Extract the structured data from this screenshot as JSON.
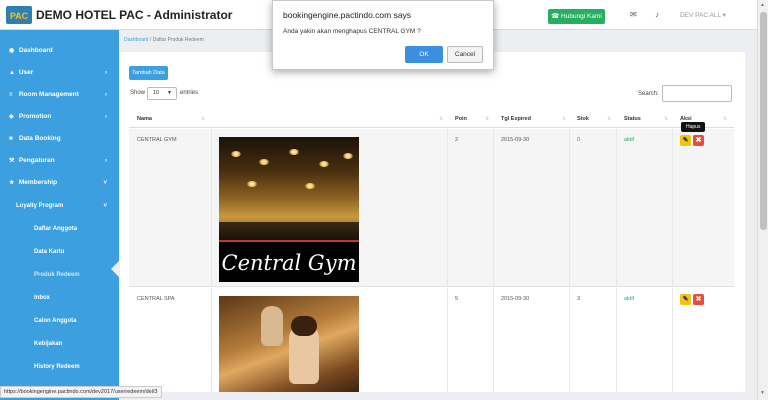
{
  "header": {
    "logo_text": "PAC",
    "title": "DEMO HOTEL PAC - Administrator",
    "contact_button": "☎ Hubungi Kami",
    "user_menu": "DEV PAC ALL ▾"
  },
  "icons": {
    "mail": "✉",
    "bell": "♪"
  },
  "sidebar": {
    "items": [
      {
        "label": "Dashboard",
        "icon": "dashboard-icon",
        "glyph": "◉",
        "chevron": ""
      },
      {
        "label": "User",
        "icon": "user-icon",
        "glyph": "▲",
        "chevron": "›"
      },
      {
        "label": "Room Management",
        "icon": "list-icon",
        "glyph": "≡",
        "chevron": "›"
      },
      {
        "label": "Promotion",
        "icon": "tag-icon",
        "glyph": "◆",
        "chevron": "›"
      },
      {
        "label": "Data Booking",
        "icon": "calendar-icon",
        "glyph": "■",
        "chevron": ""
      },
      {
        "label": "Pengaturan",
        "icon": "wrench-icon",
        "glyph": "⚒",
        "chevron": "›"
      },
      {
        "label": "Membership",
        "icon": "star-icon",
        "glyph": "★",
        "chevron": "˅"
      }
    ],
    "loyalty": {
      "label": "Loyalty Program",
      "chevron": "˅"
    },
    "subitems": [
      "Daftar Anggota",
      "Data Kartu",
      "Produk Redeem",
      "Inbox",
      "Calon Anggota",
      "Kebijakan",
      "History Redeem"
    ]
  },
  "breadcrumb": {
    "home": "Dashboard",
    "separator": " / ",
    "current": "Daftar Produk Redeem"
  },
  "panel": {
    "add_button": "Tambah Data",
    "show_label": "Show",
    "entries_value": "10",
    "entries_label": "entries",
    "search_label": "Search:"
  },
  "table": {
    "columns": [
      "Nama",
      "",
      "Poin",
      "Tgl Expired",
      "Stok",
      "Status",
      "Aksi"
    ],
    "sort_glyph": "⇅",
    "rows": [
      {
        "nama": "CENTRAL GYM",
        "image_caption": "Central Gym",
        "poin": "2",
        "expired": "2015-09-30",
        "stok": "0",
        "status": "aktif"
      },
      {
        "nama": "CENTRAL SPA",
        "image_caption": "",
        "poin": "5",
        "expired": "2015-09-30",
        "stok": "3",
        "status": "aktif"
      }
    ],
    "action_edit": "✎",
    "action_delete": "✖",
    "tooltip": "Hapus"
  },
  "dialog": {
    "title": "bookingengine.pactindo.com says",
    "message": "Anda yakin akan menghapus CENTRAL GYM ?",
    "ok": "OK",
    "cancel": "Cancel"
  },
  "status_url": "https://bookingengine.pactindo.com/dev2017/userredeem/del/3",
  "colors": {
    "sidebar": "#3c9fe0",
    "accent": "#3c9fe0",
    "contact_button": "#27ae60",
    "delete": "#e74c3c",
    "edit": "#f1c40f",
    "status_active": "#27ae60",
    "stock_zero": "#e74c3c"
  }
}
